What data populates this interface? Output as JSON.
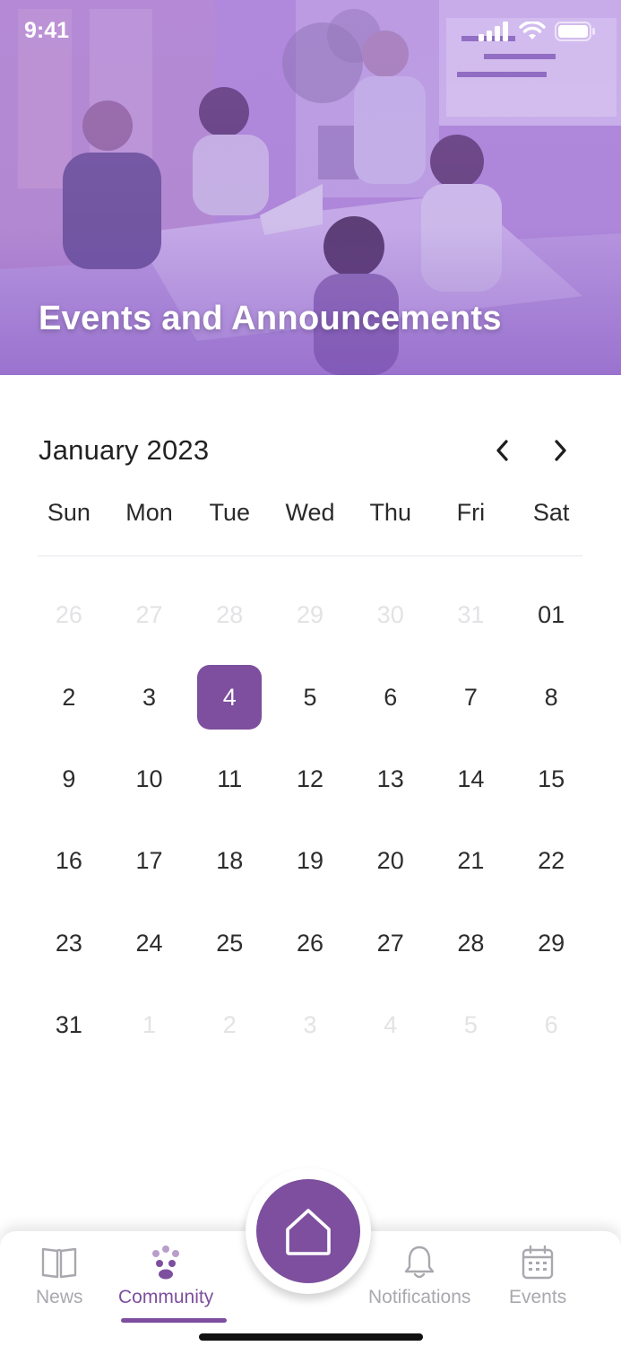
{
  "status_bar": {
    "time": "9:41"
  },
  "hero": {
    "title": "Events and Announcements"
  },
  "calendar": {
    "month_label": "January 2023",
    "prev_icon": "chevron-left-icon",
    "next_icon": "chevron-right-icon",
    "weekdays": [
      "Sun",
      "Mon",
      "Tue",
      "Wed",
      "Thu",
      "Fri",
      "Sat"
    ],
    "days": [
      {
        "label": "26",
        "muted": true
      },
      {
        "label": "27",
        "muted": true
      },
      {
        "label": "28",
        "muted": true
      },
      {
        "label": "29",
        "muted": true
      },
      {
        "label": "30",
        "muted": true
      },
      {
        "label": "31",
        "muted": true
      },
      {
        "label": "01",
        "muted": false
      },
      {
        "label": "2"
      },
      {
        "label": "3"
      },
      {
        "label": "4",
        "selected": true
      },
      {
        "label": "5"
      },
      {
        "label": "6"
      },
      {
        "label": "7"
      },
      {
        "label": "8"
      },
      {
        "label": "9"
      },
      {
        "label": "10"
      },
      {
        "label": "11"
      },
      {
        "label": "12"
      },
      {
        "label": "13"
      },
      {
        "label": "14"
      },
      {
        "label": "15"
      },
      {
        "label": "16"
      },
      {
        "label": "17"
      },
      {
        "label": "18"
      },
      {
        "label": "19"
      },
      {
        "label": "20"
      },
      {
        "label": "21"
      },
      {
        "label": "22"
      },
      {
        "label": "23"
      },
      {
        "label": "24"
      },
      {
        "label": "25"
      },
      {
        "label": "26"
      },
      {
        "label": "27"
      },
      {
        "label": "28"
      },
      {
        "label": "29"
      },
      {
        "label": "31"
      },
      {
        "label": "1",
        "muted": true
      },
      {
        "label": "2",
        "muted": true
      },
      {
        "label": "3",
        "muted": true
      },
      {
        "label": "4",
        "muted": true
      },
      {
        "label": "5",
        "muted": true
      },
      {
        "label": "6",
        "muted": true
      }
    ],
    "selected_day": "4"
  },
  "tabbar": {
    "tabs": [
      {
        "label": "News",
        "icon": "book-icon",
        "active": false
      },
      {
        "label": "Community",
        "icon": "community-icon",
        "active": true
      },
      {
        "label": "Notifications",
        "icon": "bell-icon",
        "active": false
      },
      {
        "label": "Events",
        "icon": "calendar-icon",
        "active": false
      }
    ],
    "home_icon": "home-icon"
  },
  "colors": {
    "accent": "#7d4f9e",
    "inactive_tab": "#a8a8ae",
    "muted_day": "#e3e3e6"
  }
}
